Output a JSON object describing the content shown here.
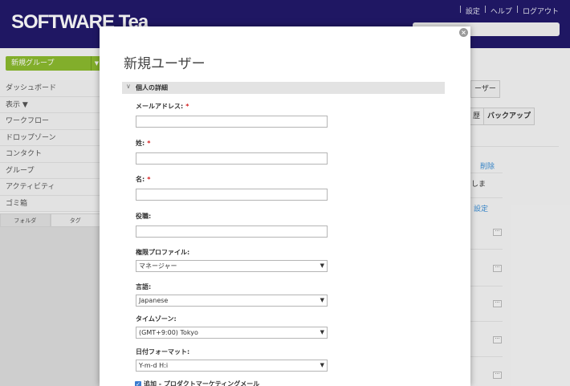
{
  "header": {
    "logo": "SOFTWARE Tea",
    "links": [
      "設定",
      "ヘルプ",
      "ログアウト"
    ],
    "separator": "|"
  },
  "sidebar": {
    "new_group_label": "新規グループ",
    "items": [
      {
        "label": "ダッシュボード"
      },
      {
        "label": "表示 ▼"
      },
      {
        "label": "ワークフロー"
      },
      {
        "label": "ドロップゾーン"
      },
      {
        "label": "コンタクト"
      },
      {
        "label": "グループ"
      },
      {
        "label": "アクティビティ"
      },
      {
        "label": "ゴミ箱"
      }
    ],
    "tabs": [
      "フォルダ",
      "タグ"
    ]
  },
  "background_right": {
    "user_button": "ーザー",
    "history_button": "歴",
    "backup_button": "バックアップ",
    "delete_link": "削除",
    "fragment_text": "しま",
    "settings_link": "設定"
  },
  "modal": {
    "title": "新規ユーザー",
    "section_title": "個人の詳細",
    "close_glyph": "×",
    "fields": {
      "email": {
        "label": "メールアドレス:",
        "value": "",
        "required": "*"
      },
      "last_name": {
        "label": "姓:",
        "value": "",
        "required": "*"
      },
      "first_name": {
        "label": "名:",
        "value": "",
        "required": "*"
      },
      "job_title": {
        "label": "役職:",
        "value": ""
      },
      "permission_profile": {
        "label": "権限プロファイル:",
        "selected": "マネージャー"
      },
      "language": {
        "label": "言語:",
        "selected": "Japanese"
      },
      "timezone": {
        "label": "タイムゾーン:",
        "selected": "(GMT+9:00) Tokyo"
      },
      "date_format": {
        "label": "日付フォーマット:",
        "selected": "Y-m-d H:i"
      }
    },
    "marketing_checkbox": {
      "label": "追加 - プロダクトマーケティングメール",
      "checked": true
    }
  },
  "colors": {
    "header_bg": "#22196b",
    "accent_green": "#8cbc2f",
    "link_blue": "#3a8ed6",
    "required_red": "#d42020"
  }
}
